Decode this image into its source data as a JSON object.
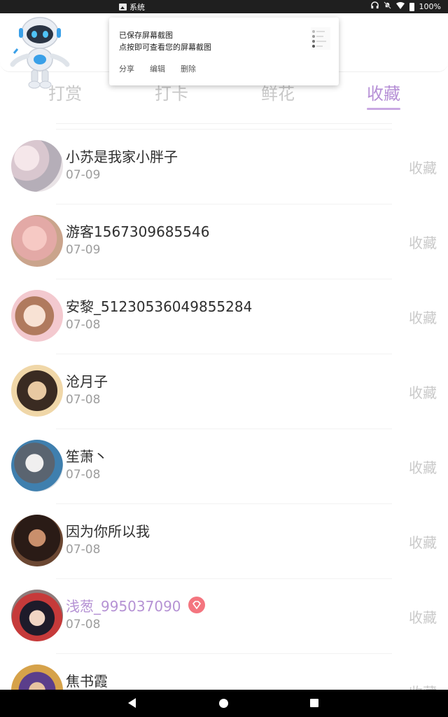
{
  "status_bar": {
    "app_label": "系统",
    "battery": "100%"
  },
  "notification": {
    "title": "已保存屏幕截图",
    "subtitle": "点按即可查看您的屏幕截图",
    "actions": [
      "分享",
      "编辑",
      "删除"
    ]
  },
  "tabs": [
    {
      "label": "打赏",
      "active": false
    },
    {
      "label": "打卡",
      "active": false
    },
    {
      "label": "鲜花",
      "active": false
    },
    {
      "label": "收藏",
      "active": true
    }
  ],
  "list": [
    {
      "name": "小苏是我家小胖子",
      "date": "07-09",
      "action": "收藏",
      "vip": false
    },
    {
      "name": "游客1567309685546",
      "date": "07-09",
      "action": "收藏",
      "vip": false
    },
    {
      "name": "安黎_51230536049855284",
      "date": "07-08",
      "action": "收藏",
      "vip": false
    },
    {
      "name": "沧月子",
      "date": "07-08",
      "action": "收藏",
      "vip": false
    },
    {
      "name": "笙萧丶",
      "date": "07-08",
      "action": "收藏",
      "vip": false
    },
    {
      "name": "因为你所以我",
      "date": "07-08",
      "action": "收藏",
      "vip": false
    },
    {
      "name": "浅葱_995037090",
      "date": "07-08",
      "action": "收藏",
      "vip": true
    },
    {
      "name": "焦书霞",
      "date": "",
      "action": "收藏",
      "vip": false
    }
  ],
  "colors": {
    "accent": "#b68fd6",
    "vip_badge": "#f4757f",
    "muted": "#c9c9c9"
  }
}
